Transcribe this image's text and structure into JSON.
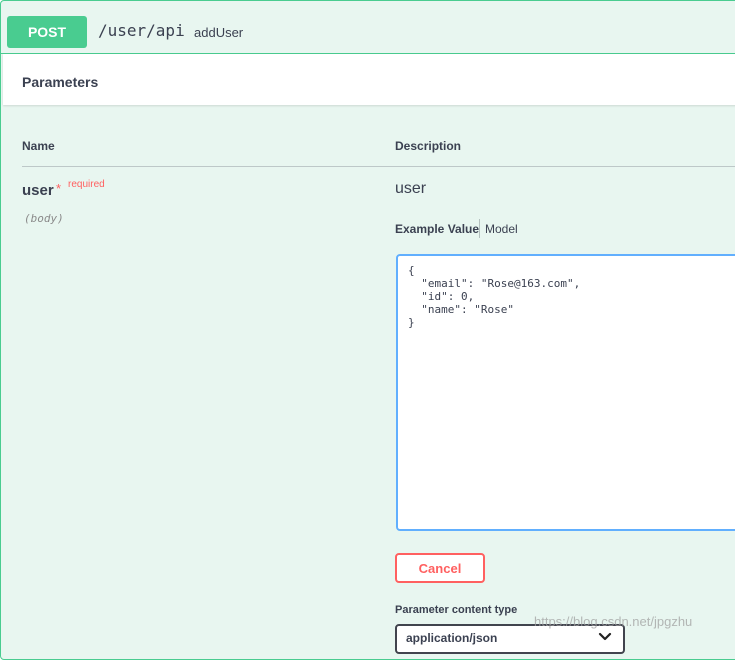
{
  "operation": {
    "method": "POST",
    "path": "/user/api",
    "summary": "addUser"
  },
  "parameters": {
    "header_title": "Parameters",
    "columns": {
      "name": "Name",
      "description": "Description"
    },
    "param": {
      "name": "user",
      "required_star": "*",
      "required_label": "required",
      "location": "(body)",
      "description": "user"
    }
  },
  "example": {
    "tab_example": "Example Value",
    "tab_model": "Model",
    "body": "{\n  \"email\": \"Rose@163.com\",\n  \"id\": 0,\n  \"name\": \"Rose\"\n}"
  },
  "actions": {
    "cancel_label": "Cancel"
  },
  "content_type": {
    "label": "Parameter content type",
    "selected": "application/json"
  },
  "watermark": "https://blog.csdn.net/jpgzhu",
  "colors": {
    "post_green": "#49cc90",
    "block_background": "#e8f6f0",
    "required_red": "#ff6060",
    "editor_border_blue": "#61affe",
    "text_dark": "#3b4151"
  }
}
